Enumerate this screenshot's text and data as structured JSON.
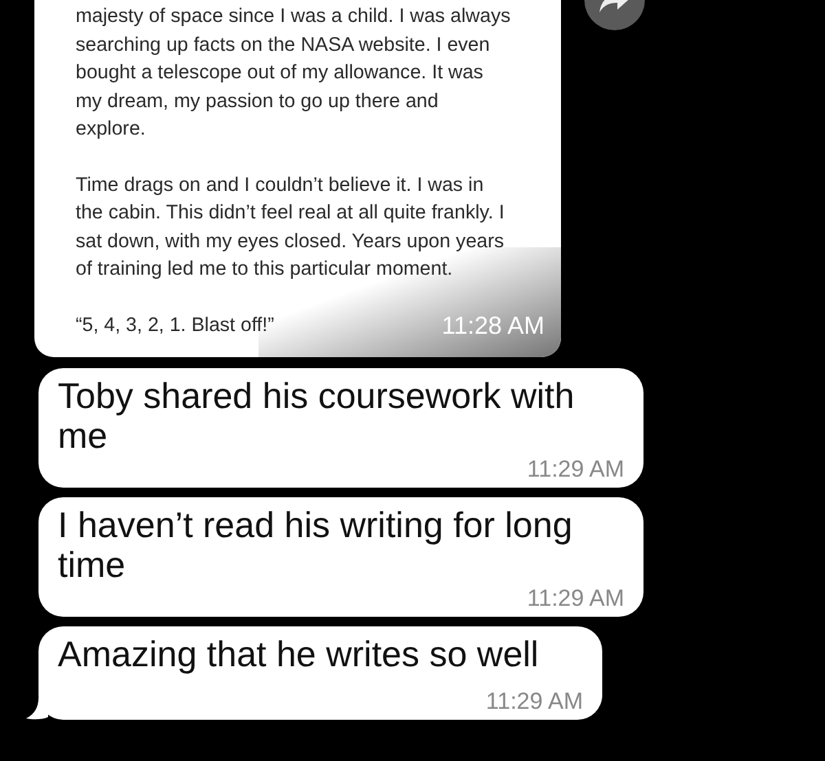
{
  "shared_post": {
    "paragraphs": [
      "majesty of space since I was a child. I was always searching up facts on the NASA website. I even bought a telescope out of my allowance. It was my dream, my passion to go up there and explore.",
      "Time drags on and I couldn’t believe it. I was in the cabin. This didn’t feel real at all quite frankly. I sat down, with my eyes closed. Years upon years of training led me to this particular moment.",
      "“5, 4, 3, 2, 1. Blast off!”"
    ],
    "time": "11:28 AM"
  },
  "messages": [
    {
      "text": "Toby shared his coursework with me",
      "time": "11:29 AM",
      "tail": false
    },
    {
      "text": "I haven’t read his writing for long time",
      "time": "11:29 AM",
      "tail": false
    },
    {
      "text": "Amazing that he writes so well",
      "time": "11:29 AM",
      "tail": true
    }
  ]
}
